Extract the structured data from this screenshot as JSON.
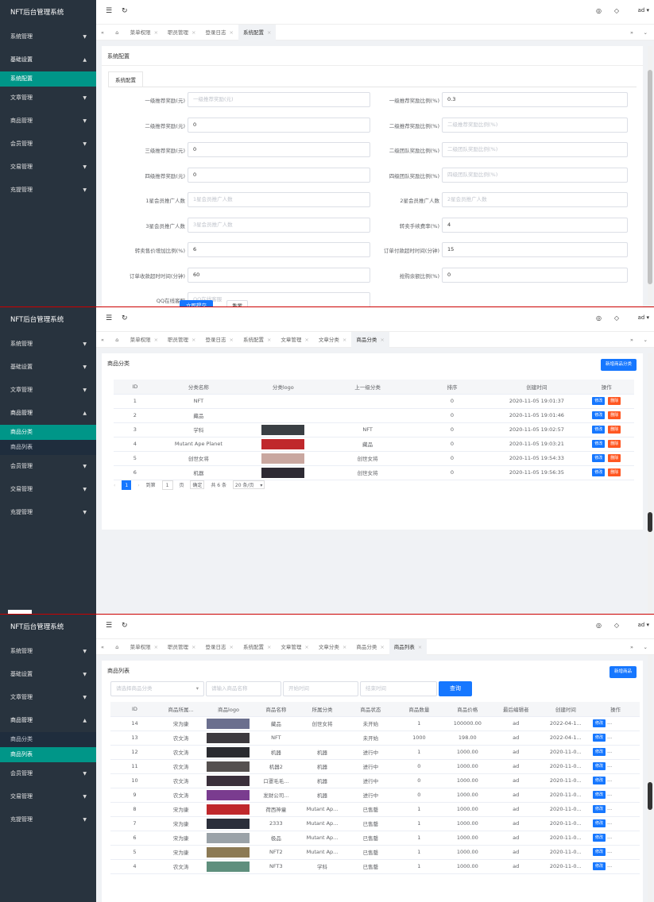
{
  "app": {
    "title": "NFT后台管理系统",
    "user": "ad"
  },
  "panel1": {
    "menu": [
      {
        "label": "系统管理",
        "state": "closed"
      },
      {
        "label": "基础设置",
        "state": "open"
      },
      {
        "label": "系统配置",
        "state": "active"
      },
      {
        "label": "文章管理",
        "state": "closed"
      },
      {
        "label": "商品管理",
        "state": "closed"
      },
      {
        "label": "会员管理",
        "state": "closed"
      },
      {
        "label": "交易管理",
        "state": "closed"
      },
      {
        "label": "充提管理",
        "state": "closed"
      }
    ],
    "tabs": [
      "菜单权限",
      "职员管理",
      "登录日志",
      "系统配置"
    ],
    "card_title": "系统配置",
    "inner_tab": "系统配置",
    "fields_left": [
      {
        "label": "一级推荐奖励(元)",
        "value": "",
        "placeholder": "一级推荐奖励(元)"
      },
      {
        "label": "二级推荐奖励(元)",
        "value": "0",
        "placeholder": ""
      },
      {
        "label": "三级推荐奖励(元)",
        "value": "0",
        "placeholder": ""
      },
      {
        "label": "四级推荐奖励(元)",
        "value": "0",
        "placeholder": ""
      },
      {
        "label": "1星会员推广人数",
        "value": "",
        "placeholder": "1星会员推广人数"
      },
      {
        "label": "3星会员推广人数",
        "value": "",
        "placeholder": "3星会员推广人数"
      },
      {
        "label": "转卖售价增加比例(%)",
        "value": "6",
        "placeholder": ""
      },
      {
        "label": "订单收款超时时间(分钟)",
        "value": "60",
        "placeholder": ""
      },
      {
        "label": "QQ在线客服",
        "value": "",
        "placeholder": "QQ在线客服"
      }
    ],
    "fields_right": [
      {
        "label": "一级推荐奖励比例(%)",
        "value": "0.3",
        "placeholder": ""
      },
      {
        "label": "二级推荐奖励比例(%)",
        "value": "",
        "placeholder": "二级推荐奖励比例(%)"
      },
      {
        "label": "二级团队奖励比例(%)",
        "value": "",
        "placeholder": "二级团队奖励比例(%)"
      },
      {
        "label": "四级团队奖励比例(%)",
        "value": "",
        "placeholder": "四级团队奖励比例(%)"
      },
      {
        "label": "2星会员推广人数",
        "value": "",
        "placeholder": "2星会员推广人数"
      },
      {
        "label": "转卖手续费率(%)",
        "value": "4",
        "placeholder": ""
      },
      {
        "label": "订单付款超时时间(分钟)",
        "value": "15",
        "placeholder": ""
      },
      {
        "label": "抢购余额比例(%)",
        "value": "0",
        "placeholder": ""
      }
    ],
    "submit": "立即提交",
    "reset": "重置"
  },
  "panel2": {
    "menu": [
      {
        "label": "系统管理",
        "state": "closed"
      },
      {
        "label": "基础设置",
        "state": "closed"
      },
      {
        "label": "文章管理",
        "state": "closed"
      },
      {
        "label": "商品管理",
        "state": "open"
      },
      {
        "label": "商品分类",
        "state": "active"
      },
      {
        "label": "商品列表",
        "state": "sub"
      },
      {
        "label": "会员管理",
        "state": "closed"
      },
      {
        "label": "交易管理",
        "state": "closed"
      },
      {
        "label": "充提管理",
        "state": "closed"
      }
    ],
    "tabs": [
      "菜单权限",
      "职员管理",
      "登录日志",
      "系统配置",
      "文章管理",
      "文章分类",
      "商品分类"
    ],
    "card_title": "商品分类",
    "add_button": "新增商品分类",
    "columns": [
      "ID",
      "分类名称",
      "分类logo",
      "上一级分类",
      "排序",
      "创建时间",
      "操作"
    ],
    "rows": [
      {
        "id": "1",
        "name": "NFT",
        "logo": "",
        "parent": "",
        "sort": "0",
        "time": "2020-11-05 19:01:37"
      },
      {
        "id": "2",
        "name": "藏品",
        "logo": "",
        "parent": "",
        "sort": "0",
        "time": "2020-11-05 19:01:46"
      },
      {
        "id": "3",
        "name": "学科",
        "logo": "#3a3f44",
        "parent": "NFT",
        "sort": "0",
        "time": "2020-11-05 19:02:57"
      },
      {
        "id": "4",
        "name": "Mutant Ape Planet",
        "logo": "#c0282c",
        "parent": "藏品",
        "sort": "0",
        "time": "2020-11-05 19:03:21"
      },
      {
        "id": "5",
        "name": "创世女将",
        "logo": "#c9a7a0",
        "parent": "创世女将",
        "sort": "0",
        "time": "2020-11-05 19:54:33"
      },
      {
        "id": "6",
        "name": "机器",
        "logo": "#2d2a33",
        "parent": "创世女将",
        "sort": "0",
        "time": "2020-11-05 19:56:35"
      }
    ],
    "edit": "修改",
    "del": "删除",
    "pager": {
      "page": "1",
      "goto": "到第",
      "goto_val": "1",
      "unit": "页",
      "confirm": "确定",
      "total": "共 6 条",
      "size": "20 条/页"
    }
  },
  "panel3": {
    "menu": [
      {
        "label": "系统管理",
        "state": "closed"
      },
      {
        "label": "基础设置",
        "state": "closed"
      },
      {
        "label": "文章管理",
        "state": "closed"
      },
      {
        "label": "商品管理",
        "state": "open"
      },
      {
        "label": "商品分类",
        "state": "sub"
      },
      {
        "label": "商品列表",
        "state": "active"
      },
      {
        "label": "会员管理",
        "state": "closed"
      },
      {
        "label": "交易管理",
        "state": "closed"
      },
      {
        "label": "充提管理",
        "state": "closed"
      }
    ],
    "tabs": [
      "菜单权限",
      "职员管理",
      "登录日志",
      "系统配置",
      "文章管理",
      "文章分类",
      "商品分类",
      "商品列表"
    ],
    "card_title": "商品列表",
    "add_button": "新增商品",
    "filters": {
      "category": "请选择商品分类",
      "name": "请输入商品名称",
      "start": "开始时间",
      "end": "结束时间",
      "query": "查询"
    },
    "columns": [
      "ID",
      "商品所属...",
      "商品logo",
      "商品名称",
      "所属分类",
      "商品状态",
      "商品数量",
      "商品价格",
      "最后编辑者",
      "创建时间",
      "操作"
    ],
    "rows": [
      {
        "id": "14",
        "owner": "宋为康",
        "logo": "#6b6f8e",
        "name": "藏品",
        "cat": "创世女将",
        "status": "未开始",
        "qty": "1",
        "price": "100000.00",
        "editor": "ad",
        "time": "2022-04-1..."
      },
      {
        "id": "13",
        "owner": "农文涛",
        "logo": "#3d3a3f",
        "name": "NFT",
        "cat": "",
        "status": "未开始",
        "qty": "1000",
        "price": "198.00",
        "editor": "ad",
        "time": "2022-04-1..."
      },
      {
        "id": "12",
        "owner": "农文涛",
        "logo": "#2a2b30",
        "name": "机器",
        "cat": "机器",
        "status": "进行中",
        "qty": "1",
        "price": "1000.00",
        "editor": "ad",
        "time": "2020-11-0..."
      },
      {
        "id": "11",
        "owner": "农文涛",
        "logo": "#55504f",
        "name": "机器2",
        "cat": "机器",
        "status": "进行中",
        "qty": "0",
        "price": "1000.00",
        "editor": "ad",
        "time": "2020-11-0..."
      },
      {
        "id": "10",
        "owner": "农文涛",
        "logo": "#3a2f3b",
        "name": "口罩毛毛...",
        "cat": "机器",
        "status": "进行中",
        "qty": "0",
        "price": "1000.00",
        "editor": "ad",
        "time": "2020-11-0..."
      },
      {
        "id": "9",
        "owner": "农文涛",
        "logo": "#7a3c8f",
        "name": "发财公司...",
        "cat": "机器",
        "status": "进行中",
        "qty": "0",
        "price": "1000.00",
        "editor": "ad",
        "time": "2020-11-0..."
      },
      {
        "id": "8",
        "owner": "宋为康",
        "logo": "#c0282c",
        "name": "荷西神童",
        "cat": "Mutant Ap...",
        "status": "已售罄",
        "qty": "1",
        "price": "1000.00",
        "editor": "ad",
        "time": "2020-11-0..."
      },
      {
        "id": "7",
        "owner": "宋为康",
        "logo": "#2b2f3a",
        "name": "2333",
        "cat": "Mutant Ap...",
        "status": "已售罄",
        "qty": "1",
        "price": "1000.00",
        "editor": "ad",
        "time": "2020-11-0..."
      },
      {
        "id": "6",
        "owner": "宋为康",
        "logo": "#9aa2a8",
        "name": "极品",
        "cat": "Mutant Ap...",
        "status": "已售罄",
        "qty": "1",
        "price": "1000.00",
        "editor": "ad",
        "time": "2020-11-0..."
      },
      {
        "id": "5",
        "owner": "宋为康",
        "logo": "#8c7a55",
        "name": "NFT2",
        "cat": "Mutant Ap...",
        "status": "已售罄",
        "qty": "1",
        "price": "1000.00",
        "editor": "ad",
        "time": "2020-11-0..."
      },
      {
        "id": "4",
        "owner": "农文涛",
        "logo": "#5f8f7d",
        "name": "NFT3",
        "cat": "学科",
        "status": "已售罄",
        "qty": "1",
        "price": "1000.00",
        "editor": "ad",
        "time": "2020-11-0..."
      }
    ],
    "edit": "修改",
    "more": "..."
  }
}
